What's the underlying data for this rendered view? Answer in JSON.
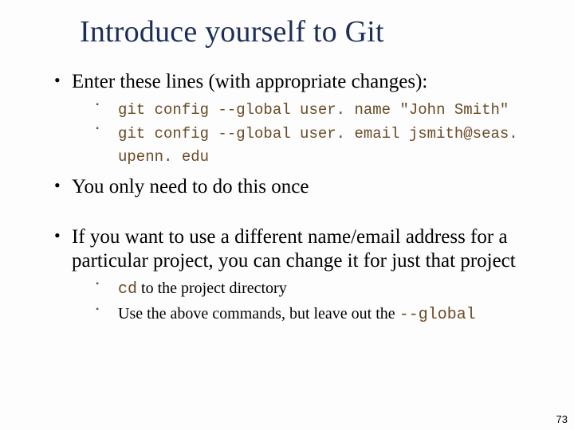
{
  "title": "Introduce yourself to Git",
  "bullets": {
    "b1": "Enter these lines (with appropriate changes):",
    "b1_sub": {
      "a": "git config --global user. name \"John Smith\"",
      "b": "git config --global user. email jsmith@seas. upenn. edu"
    },
    "b2": "You only need to do this once",
    "b3": "If you want to use a different name/email address for a particular project, you can change it for just that project",
    "b3_sub": {
      "a_code": "cd",
      "a_rest": " to the project directory",
      "b_pre": "Use the above commands, but leave out the ",
      "b_code": "--global"
    }
  },
  "page_number": "73"
}
